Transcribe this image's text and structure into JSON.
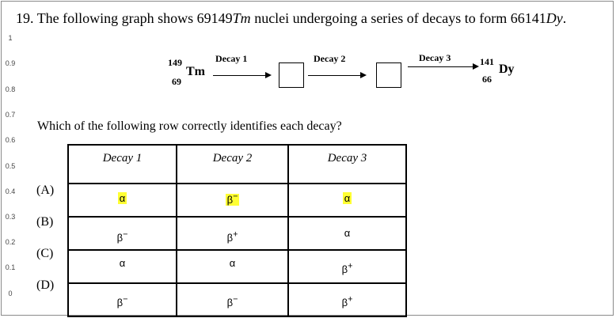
{
  "question": {
    "number": "19.",
    "text_before": "The following graph shows 69149",
    "parent_symbol": "Tm",
    "text_middle": " nuclei undergoing a series of decays to form 66141",
    "daughter_symbol": "Dy",
    "text_end": "."
  },
  "y_ticks": [
    "1",
    "0.9",
    "0.8",
    "0.7",
    "0.6",
    "0.5",
    "0.4",
    "0.3",
    "0.2",
    "0.1",
    "0"
  ],
  "diagram": {
    "parent": {
      "mass": "149",
      "atomic": "69",
      "symbol": "Tm"
    },
    "product": {
      "mass": "141",
      "atomic": "66",
      "symbol": "Dy"
    },
    "decays": [
      "Decay 1",
      "Decay 2",
      "Decay 3"
    ]
  },
  "prompt": "Which of the following row correctly identifies each decay?",
  "table": {
    "headers": [
      "Decay 1",
      "Decay 2",
      "Decay 3"
    ],
    "rows": [
      {
        "label": "(A)",
        "cells": [
          {
            "base": "α",
            "sup": "",
            "highlight": true
          },
          {
            "base": "β",
            "sup": "−",
            "highlight": true
          },
          {
            "base": "α",
            "sup": "",
            "highlight": true
          }
        ]
      },
      {
        "label": "(B)",
        "cells": [
          {
            "base": "β",
            "sup": "−",
            "highlight": false
          },
          {
            "base": "β",
            "sup": "+",
            "highlight": false
          },
          {
            "base": "α",
            "sup": "",
            "highlight": false
          }
        ]
      },
      {
        "label": "(C)",
        "cells": [
          {
            "base": "α",
            "sup": "",
            "highlight": false
          },
          {
            "base": "α",
            "sup": "",
            "highlight": false
          },
          {
            "base": "β",
            "sup": "+",
            "highlight": false
          }
        ]
      },
      {
        "label": "(D)",
        "cells": [
          {
            "base": "β",
            "sup": "−",
            "highlight": false
          },
          {
            "base": "β",
            "sup": "−",
            "highlight": false
          },
          {
            "base": "β",
            "sup": "+",
            "highlight": false
          }
        ]
      }
    ]
  },
  "colors": {
    "highlight": "#ffff33",
    "frame": "#8a8a8a"
  }
}
